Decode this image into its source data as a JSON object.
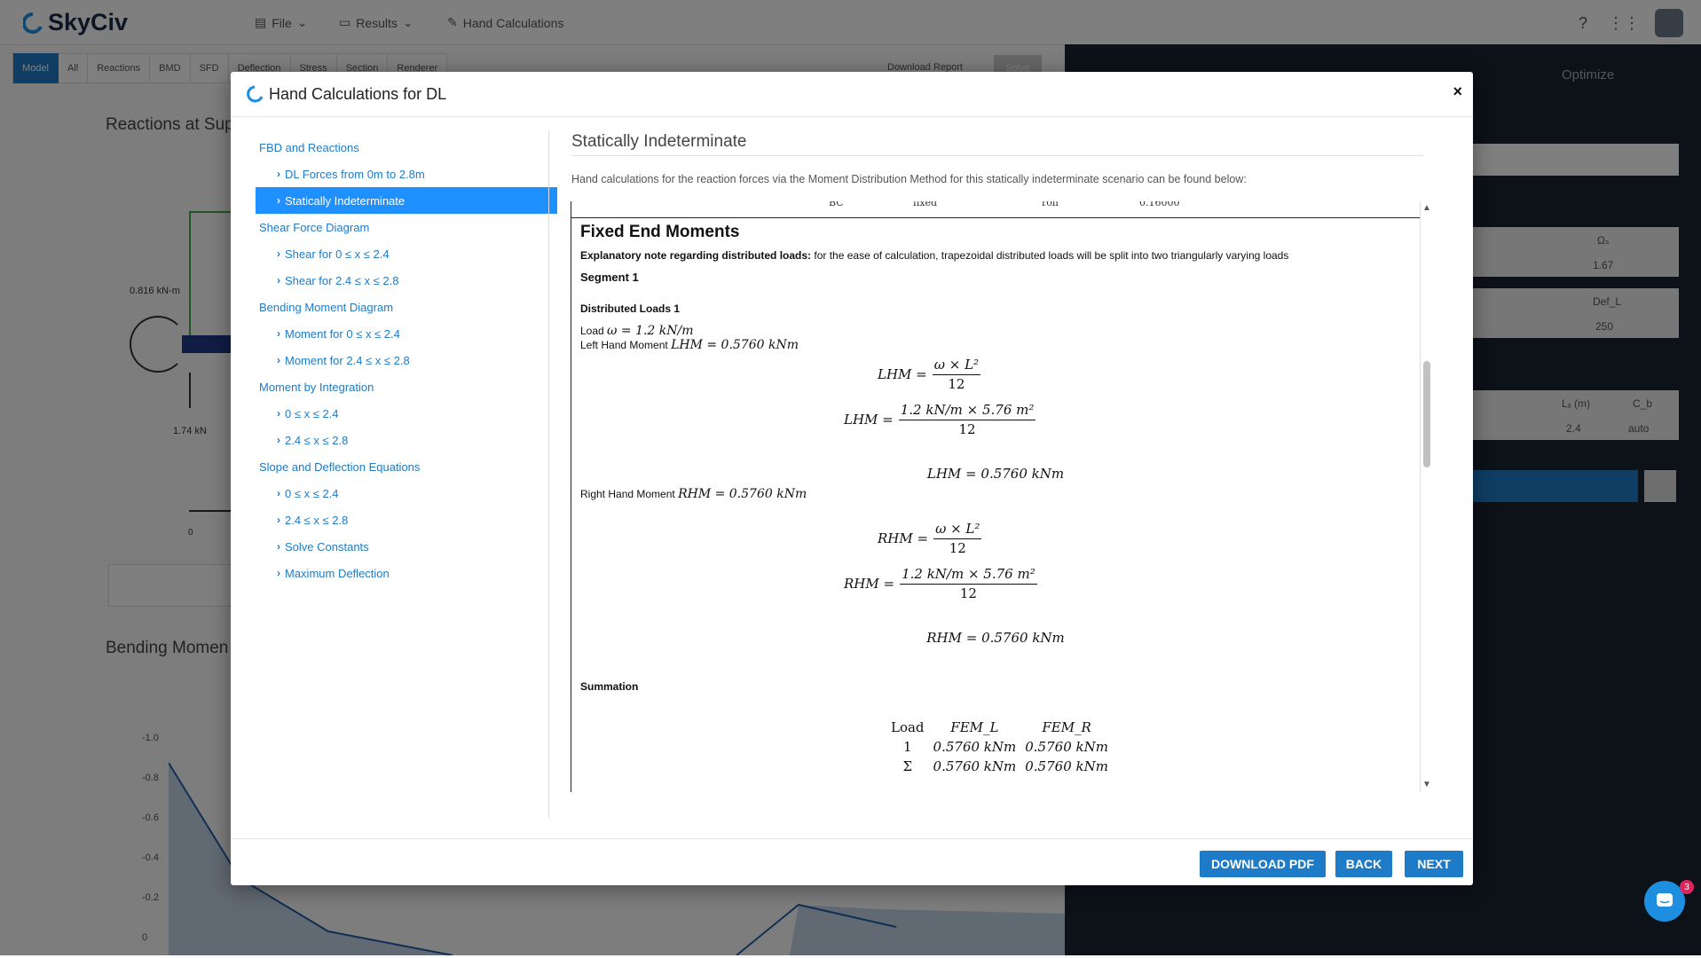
{
  "app": {
    "logo_text": "SkyCiv",
    "menu": [
      {
        "label": "File",
        "icon": "file-icon"
      },
      {
        "label": "Results",
        "icon": "monitor-icon"
      },
      {
        "label": "Hand Calculations",
        "icon": "pencil-icon"
      }
    ],
    "tabs": [
      "Model",
      "All",
      "Reactions",
      "BMD",
      "SFD",
      "Deflection",
      "Stress",
      "Section",
      "Renderer"
    ],
    "download_report": "Download Report",
    "solve": "Solve",
    "optimize": "Optimize",
    "bg_titles": [
      "Reactions at Sup",
      "Bending Momen"
    ],
    "bg_labels": {
      "moment": "0.816 kN-m",
      "force": "1.74 kN",
      "zero": "0"
    },
    "bg_axis": [
      "-1.0",
      "-0.8",
      "-0.6",
      "-0.4",
      "-0.2",
      "0"
    ],
    "right_panel": {
      "omega": "Ωₛ",
      "omega_val": "1.67",
      "def": "Def_L",
      "def_val": "250",
      "lx": "Lₓ (m)",
      "lx_val": "2.4",
      "cb": "C_b",
      "cb_val": "auto"
    },
    "chat_badge": "3"
  },
  "modal": {
    "title": "Hand Calculations for DL",
    "close": "×",
    "sidebar": [
      {
        "label": "FBD and Reactions",
        "level": "sec"
      },
      {
        "label": "DL Forces from 0m to 2.8m",
        "level": "sub"
      },
      {
        "label": "Statically Indeterminate",
        "level": "sub",
        "active": true
      },
      {
        "label": "Shear Force Diagram",
        "level": "sec"
      },
      {
        "label": "Shear for 0 ≤ x ≤ 2.4",
        "level": "sub"
      },
      {
        "label": "Shear for 2.4 ≤ x ≤ 2.8",
        "level": "sub"
      },
      {
        "label": "Bending Moment Diagram",
        "level": "sec"
      },
      {
        "label": "Moment for 0 ≤ x ≤ 2.4",
        "level": "sub"
      },
      {
        "label": "Moment for 2.4 ≤ x ≤ 2.8",
        "level": "sub"
      },
      {
        "label": "Moment by Integration",
        "level": "sec"
      },
      {
        "label": "0 ≤ x ≤ 2.4",
        "level": "sub"
      },
      {
        "label": "2.4 ≤ x ≤ 2.8",
        "level": "sub"
      },
      {
        "label": "Slope and Deflection Equations",
        "level": "sec"
      },
      {
        "label": "0 ≤ x ≤ 2.4",
        "level": "sub"
      },
      {
        "label": "2.4 ≤ x ≤ 2.8",
        "level": "sub"
      },
      {
        "label": "Solve Constants",
        "level": "sub"
      },
      {
        "label": "Maximum Deflection",
        "level": "sub"
      }
    ],
    "content": {
      "title": "Statically Indeterminate",
      "description": "Hand calculations for the reaction forces via the Moment Distribution Method for this statically indeterminate scenario can be found below:",
      "cut_row": [
        "BC",
        "fixed",
        "roll",
        "0.16000"
      ],
      "section_heading": "Fixed End Moments",
      "note_bold": "Explanatory note regarding distributed loads:",
      "note_text": " for the ease of calculation, trapezoidal distributed loads will be split into two triangularly varying loads",
      "segment": "Segment 1",
      "loads_heading": "Distributed Loads 1",
      "load_prefix": "Load ",
      "load_eq": "ω = 1.2 kN/m",
      "lhm_prefix": "Left Hand Moment ",
      "lhm_eq": "LHM = 0.5760 kNm",
      "lhm_formula": {
        "lhs": "LHM =",
        "num": "ω × L²",
        "den": "12"
      },
      "lhm_subst": {
        "lhs": "LHM =",
        "num": "1.2 kN/m × 5.76 m²",
        "den": "12"
      },
      "lhm_result": "LHM = 0.5760 kNm",
      "rhm_prefix": "Right Hand Moment ",
      "rhm_eq": "RHM = 0.5760 kNm",
      "rhm_formula": {
        "lhs": "RHM =",
        "num": "ω × L²",
        "den": "12"
      },
      "rhm_subst": {
        "lhs": "RHM =",
        "num": "1.2 kN/m × 5.76 m²",
        "den": "12"
      },
      "rhm_result": "RHM = 0.5760 kNm",
      "summation_heading": "Summation",
      "summation": {
        "headers": [
          "Load",
          "FEM_L",
          "FEM_R"
        ],
        "rows": [
          [
            "1",
            "0.5760 kNm",
            "0.5760 kNm"
          ],
          [
            "Σ",
            "0.5760 kNm",
            "0.5760 kNm"
          ]
        ]
      }
    },
    "buttons": {
      "download_pdf": "DOWNLOAD PDF",
      "back": "BACK",
      "next": "NEXT"
    }
  }
}
